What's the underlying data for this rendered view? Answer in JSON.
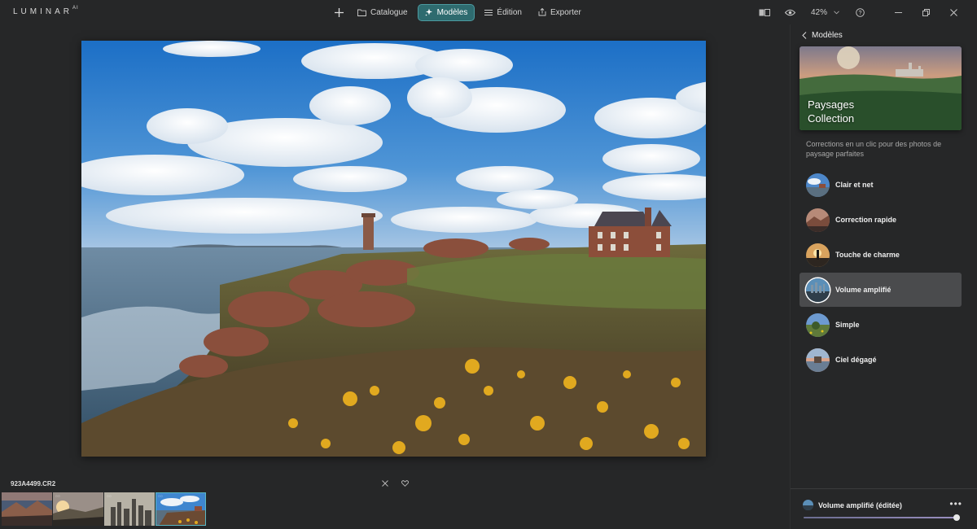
{
  "app": {
    "logo": "LUMINAR",
    "logo_sup": "AI"
  },
  "nav": {
    "catalogue": "Catalogue",
    "modeles": "Modèles",
    "edition": "Édition",
    "exporter": "Exporter"
  },
  "tools": {
    "zoom": "42%"
  },
  "filmstrip": {
    "filename": "923A4499.CR2",
    "thumbs": [
      {
        "badge": "",
        "selected": false
      },
      {
        "badge": "◌◌",
        "selected": false
      },
      {
        "badge": "◌◌",
        "selected": false
      },
      {
        "badge": "◌◌",
        "selected": true
      }
    ]
  },
  "panel": {
    "back_label": "Modèles",
    "hero_title": "Paysages",
    "hero_sub": "Collection",
    "description": "Corrections en un clic pour des photos de paysage parfaites",
    "presets": [
      {
        "label": "Clair et net",
        "active": false
      },
      {
        "label": "Correction rapide",
        "active": false
      },
      {
        "label": "Touche de charme",
        "active": false
      },
      {
        "label": "Volume amplifié",
        "active": true
      },
      {
        "label": "Simple",
        "active": false
      },
      {
        "label": "Ciel dégagé",
        "active": false
      }
    ],
    "edited_label": "Volume amplifié (éditée)",
    "more_label": "•••",
    "amount": 1.0
  },
  "colors": {
    "accent": "#2e6b6f",
    "accent_border": "#4c9aa0",
    "selection": "#5ab7c4"
  }
}
